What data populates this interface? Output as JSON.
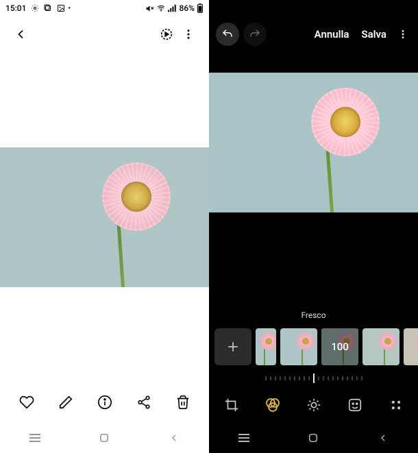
{
  "status": {
    "time": "15:01",
    "battery": "86%"
  },
  "editor": {
    "cancel_label": "Annulla",
    "save_label": "Salva",
    "filter_name": "Fresco",
    "filter_intensity": "100"
  }
}
